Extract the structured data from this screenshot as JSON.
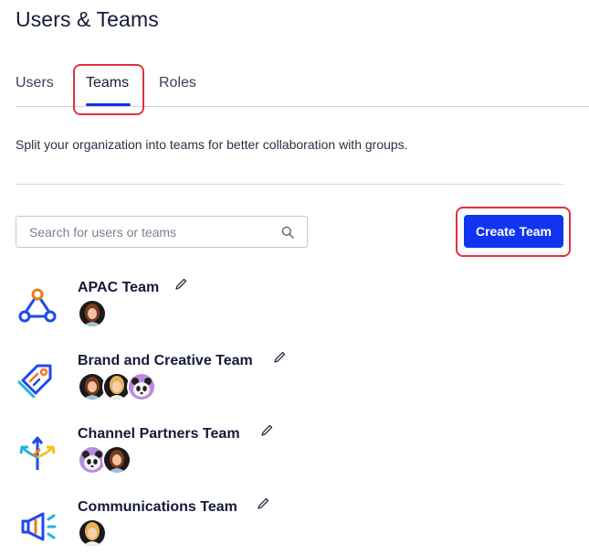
{
  "page": {
    "title": "Users & Teams"
  },
  "tabs": [
    {
      "label": "Users",
      "active": false
    },
    {
      "label": "Teams",
      "active": true
    },
    {
      "label": "Roles",
      "active": false
    }
  ],
  "description": "Split your organization into teams for better collaboration with groups.",
  "search": {
    "placeholder": "Search for users or teams",
    "value": ""
  },
  "actions": {
    "create_team_label": "Create Team"
  },
  "colors": {
    "accent": "#1034f0",
    "highlight": "#e0303f",
    "tab_underline": "#1034e0"
  },
  "teams": [
    {
      "name": "APAC Team",
      "icon": "network-nodes-icon",
      "avatars": [
        "woman-avatar"
      ]
    },
    {
      "name": "Brand and Creative Team",
      "icon": "price-tag-icon",
      "avatars": [
        "woman-avatar",
        "woman-blonde-avatar",
        "panda-avatar"
      ]
    },
    {
      "name": "Channel Partners Team",
      "icon": "split-arrows-icon",
      "avatars": [
        "panda-avatar",
        "woman-avatar"
      ]
    },
    {
      "name": "Communications Team",
      "icon": "megaphone-icon",
      "avatars": [
        "woman-blonde-avatar"
      ]
    }
  ]
}
